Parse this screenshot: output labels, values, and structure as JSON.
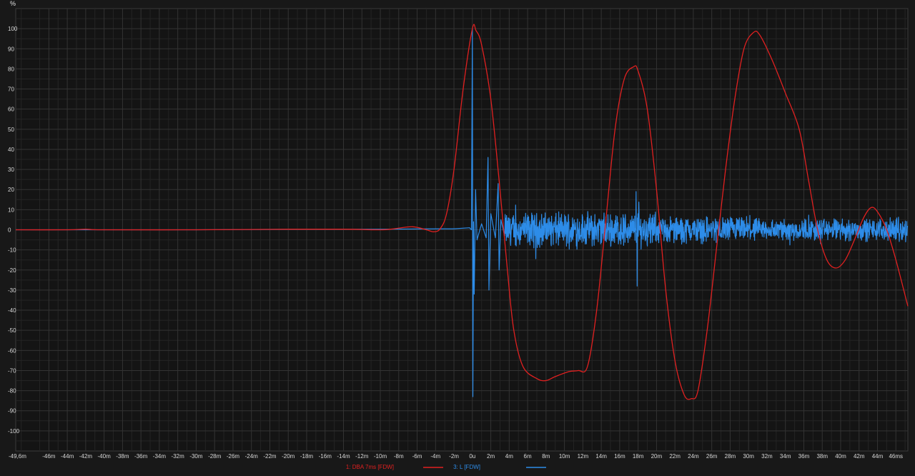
{
  "chart_data": {
    "type": "line",
    "ylabel": "%",
    "ylim": [
      -110,
      110
    ],
    "xlim": [
      -49.6,
      47.3
    ],
    "grid": true,
    "legend_position": "bottom-center",
    "y_ticks": [
      {
        "v": 100,
        "label": "100"
      },
      {
        "v": 90,
        "label": "90"
      },
      {
        "v": 80,
        "label": "80"
      },
      {
        "v": 70,
        "label": "70"
      },
      {
        "v": 60,
        "label": "60"
      },
      {
        "v": 50,
        "label": "50"
      },
      {
        "v": 40,
        "label": "40"
      },
      {
        "v": 30,
        "label": "30"
      },
      {
        "v": 20,
        "label": "20"
      },
      {
        "v": 10,
        "label": "10"
      },
      {
        "v": 0,
        "label": "0"
      },
      {
        "v": -10,
        "label": "-10"
      },
      {
        "v": -20,
        "label": "-20"
      },
      {
        "v": -30,
        "label": "-30"
      },
      {
        "v": -40,
        "label": "-40"
      },
      {
        "v": -50,
        "label": "-50"
      },
      {
        "v": -60,
        "label": "-60"
      },
      {
        "v": -70,
        "label": "-70"
      },
      {
        "v": -80,
        "label": "-80"
      },
      {
        "v": -90,
        "label": "-90"
      },
      {
        "v": -100,
        "label": "-100"
      }
    ],
    "x_ticks": [
      {
        "v": -49.6,
        "label": "-49,6m"
      },
      {
        "v": -46,
        "label": "-46m"
      },
      {
        "v": -44,
        "label": "-44m"
      },
      {
        "v": -42,
        "label": "-42m"
      },
      {
        "v": -40,
        "label": "-40m"
      },
      {
        "v": -38,
        "label": "-38m"
      },
      {
        "v": -36,
        "label": "-36m"
      },
      {
        "v": -34,
        "label": "-34m"
      },
      {
        "v": -32,
        "label": "-32m"
      },
      {
        "v": -30,
        "label": "-30m"
      },
      {
        "v": -28,
        "label": "-28m"
      },
      {
        "v": -26,
        "label": "-26m"
      },
      {
        "v": -24,
        "label": "-24m"
      },
      {
        "v": -22,
        "label": "-22m"
      },
      {
        "v": -20,
        "label": "-20m"
      },
      {
        "v": -18,
        "label": "-18m"
      },
      {
        "v": -16,
        "label": "-16m"
      },
      {
        "v": -14,
        "label": "-14m"
      },
      {
        "v": -12,
        "label": "-12m"
      },
      {
        "v": -10,
        "label": "-10m"
      },
      {
        "v": -8,
        "label": "-8m"
      },
      {
        "v": -6,
        "label": "-6m"
      },
      {
        "v": -4,
        "label": "-4m"
      },
      {
        "v": -2,
        "label": "-2m"
      },
      {
        "v": 0,
        "label": "0u"
      },
      {
        "v": 2,
        "label": "2m"
      },
      {
        "v": 4,
        "label": "4m"
      },
      {
        "v": 6,
        "label": "6m"
      },
      {
        "v": 8,
        "label": "8m"
      },
      {
        "v": 10,
        "label": "10m"
      },
      {
        "v": 12,
        "label": "12m"
      },
      {
        "v": 14,
        "label": "14m"
      },
      {
        "v": 16,
        "label": "16m"
      },
      {
        "v": 18,
        "label": "18m"
      },
      {
        "v": 20,
        "label": "20m"
      },
      {
        "v": 22,
        "label": "22m"
      },
      {
        "v": 24,
        "label": "24m"
      },
      {
        "v": 26,
        "label": "26m"
      },
      {
        "v": 28,
        "label": "28m"
      },
      {
        "v": 30,
        "label": "30m"
      },
      {
        "v": 32,
        "label": "32m"
      },
      {
        "v": 34,
        "label": "34m"
      },
      {
        "v": 36,
        "label": "36m"
      },
      {
        "v": 38,
        "label": "38m"
      },
      {
        "v": 40,
        "label": "40m"
      },
      {
        "v": 42,
        "label": "42m"
      },
      {
        "v": 44,
        "label": "44m"
      },
      {
        "v": 46,
        "label": "46ms"
      }
    ],
    "series": [
      {
        "name": "1: DBA 7ms [FDW]",
        "color": "#e02020",
        "points": [
          [
            -49.6,
            0
          ],
          [
            -44,
            0
          ],
          [
            -42,
            0.3
          ],
          [
            -40,
            0
          ],
          [
            -30,
            0
          ],
          [
            -20,
            0.3
          ],
          [
            -14,
            0.3
          ],
          [
            -10,
            0
          ],
          [
            -8.5,
            0.5
          ],
          [
            -6.5,
            1.5
          ],
          [
            -5,
            0
          ],
          [
            -4.2,
            -1
          ],
          [
            -3.5,
            0.5
          ],
          [
            -2.8,
            8
          ],
          [
            -2,
            30
          ],
          [
            -1,
            70
          ],
          [
            0,
            100
          ],
          [
            0.4,
            99
          ],
          [
            1,
            92
          ],
          [
            2,
            65
          ],
          [
            3,
            20
          ],
          [
            3.8,
            -20
          ],
          [
            4.5,
            -50
          ],
          [
            5.5,
            -68
          ],
          [
            7,
            -74
          ],
          [
            8,
            -75
          ],
          [
            9,
            -73
          ],
          [
            10.5,
            -70.5
          ],
          [
            11.5,
            -70
          ],
          [
            12.5,
            -68
          ],
          [
            13.5,
            -40
          ],
          [
            14.5,
            5
          ],
          [
            15.5,
            50
          ],
          [
            16.5,
            75
          ],
          [
            17.5,
            81
          ],
          [
            18,
            79
          ],
          [
            19,
            60
          ],
          [
            20,
            20
          ],
          [
            21,
            -30
          ],
          [
            22,
            -65
          ],
          [
            23,
            -82
          ],
          [
            23.8,
            -84
          ],
          [
            24.5,
            -80
          ],
          [
            25.5,
            -50
          ],
          [
            26.5,
            -10
          ],
          [
            27.5,
            30
          ],
          [
            28.5,
            65
          ],
          [
            29.5,
            90
          ],
          [
            30.5,
            98
          ],
          [
            31.2,
            97
          ],
          [
            32.5,
            85
          ],
          [
            34,
            68
          ],
          [
            35.5,
            50
          ],
          [
            36.5,
            25
          ],
          [
            37.5,
            0
          ],
          [
            38.5,
            -15
          ],
          [
            39.5,
            -19
          ],
          [
            40.5,
            -15
          ],
          [
            41.5,
            -5
          ],
          [
            42.5,
            6
          ],
          [
            43.3,
            11
          ],
          [
            44,
            9
          ],
          [
            45,
            0
          ],
          [
            46,
            -15
          ],
          [
            47.3,
            -38
          ]
        ]
      },
      {
        "name": "3: L [FDW]",
        "color": "#2d8ce8",
        "noise_start": 0.1,
        "points": [
          [
            -49.6,
            0
          ],
          [
            -30,
            0
          ],
          [
            -20,
            0.2
          ],
          [
            -10,
            0.3
          ],
          [
            -4,
            0.5
          ],
          [
            -2,
            0.5
          ],
          [
            -0.3,
            1
          ],
          [
            -0.1,
            0
          ],
          [
            0,
            100
          ],
          [
            0.05,
            -83
          ],
          [
            0.12,
            4
          ],
          [
            0.2,
            -32
          ],
          [
            0.35,
            20
          ],
          [
            0.5,
            -5
          ],
          [
            1,
            3
          ],
          [
            1.5,
            -4
          ],
          [
            1.7,
            36
          ],
          [
            1.8,
            -30
          ],
          [
            2,
            8
          ],
          [
            2.5,
            -4
          ],
          [
            2.8,
            23
          ],
          [
            2.9,
            -20
          ],
          [
            3.1,
            5
          ],
          [
            3.5,
            -3
          ]
        ],
        "spikes": [
          [
            17.8,
            19
          ],
          [
            17.9,
            -28
          ],
          [
            18.0,
            8
          ]
        ]
      }
    ]
  }
}
